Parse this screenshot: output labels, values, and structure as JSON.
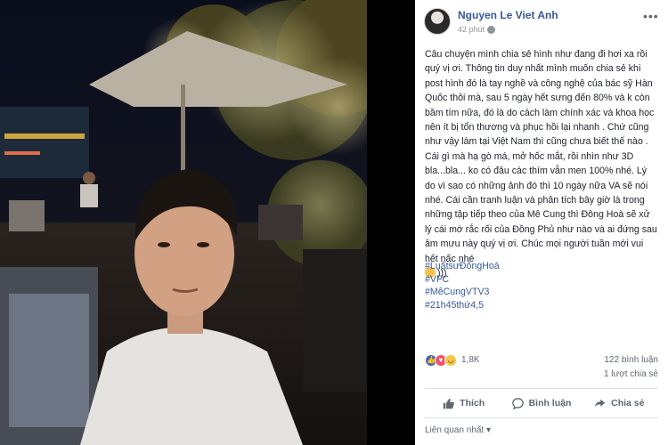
{
  "post": {
    "author": "Nguyen Le Viet Anh",
    "time": "42 phút",
    "body": [
      "Câu chuyện mình chia sẻ hình như đang đi hơi xa rồi quý vị ơi. Thông tin duy nhất mình muốn chia sẻ khi post hình đó là tay nghề và công nghệ của bác sỹ Hàn Quốc thôi mà, sau 5 ngày hết sưng đến 80% và k còn bầm tím nữa, đó là do cách làm chính xác và khoa học nên ít bị tổn thương và phục hồi lại nhanh . Chứ cũng như vậy làm tại Việt Nam thì cũng chưa biết thế nào . Cái gì mà hạ gò má, mở hốc mắt, rồi nhìn như 3D bla...bla... ko có đâu các thím vẫn men 100% nhé. Lý do vì sao có những ảnh đó thì 10 ngày nữa VA sẽ nói nhé. Cái cần tranh luận và phân tích bây giờ là trong những tập tiếp theo của Mê Cung thì Đông Hoà sẽ xử lý cái mớ rắc rối của Đồng Phủ như nào và ai đứng sau âm mưu này quý vị ơi. Chúc mọi người tuần mới vui hết nấc nhé",
      ")))"
    ],
    "hashtags": [
      "#LuậtsưĐôngHoà",
      "#VFC",
      "#MêCungVTV3",
      "#21h45thứ4,5"
    ],
    "reaction_count": "1,8K",
    "comments": "122 bình luận",
    "shares": "1 lượt chia sẻ"
  },
  "actions": {
    "like": "Thích",
    "comment": "Bình luận",
    "share": "Chia sẻ"
  },
  "sort_label": "Liên quan nhất ▾",
  "colors": {
    "link": "#385898",
    "like": "#4267b2",
    "love": "#f25268",
    "haha": "#f7c34a"
  },
  "icons": [
    "globe-icon",
    "more-icon",
    "like-icon",
    "love-icon",
    "haha-icon",
    "thumb-icon",
    "comment-icon",
    "share-icon"
  ]
}
